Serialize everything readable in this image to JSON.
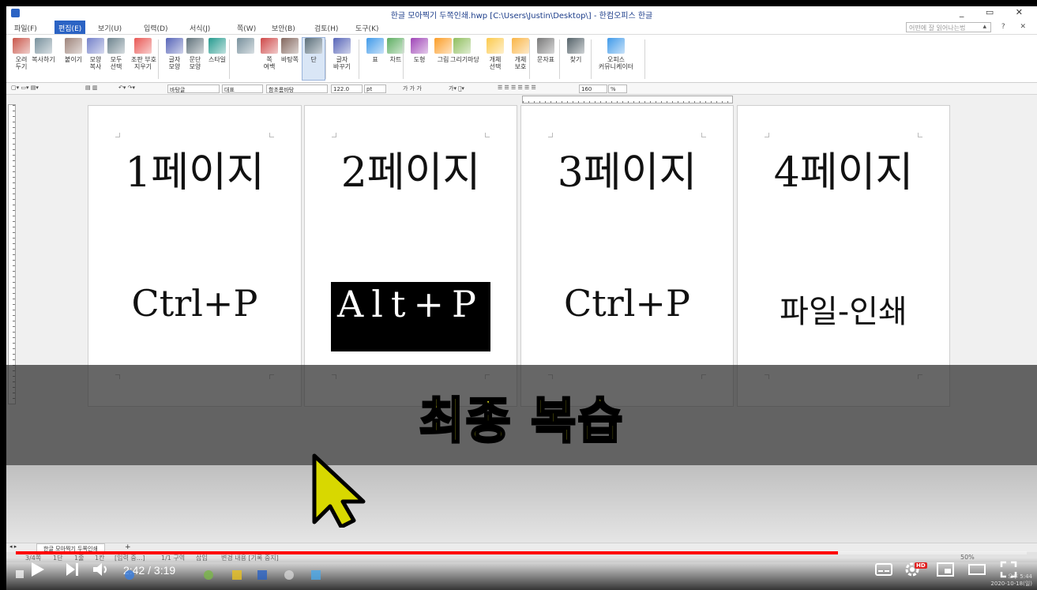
{
  "window": {
    "title": "한글 모아찍기 두쪽인쇄.hwp [C:\\Users\\Justin\\Desktop\\] - 한컴오피스 한글",
    "controls": "_ ▭ ✕"
  },
  "menu": {
    "items": [
      "파일(F)",
      "편집(E)",
      "보기(U)",
      "입력(D)",
      "서식(J)",
      "쪽(W)",
      "보안(B)",
      "검토(H)",
      "도구(K)"
    ],
    "active_index": 1,
    "help_placeholder": "어떤에 잘 읽어나는법",
    "right_controls": "▴ ? ✕"
  },
  "ribbon": {
    "buttons": [
      {
        "label": "오려\n두기",
        "icon": "scissors-icon"
      },
      {
        "label": "복사하기",
        "icon": "copy-icon"
      },
      {
        "label": "붙이기",
        "icon": "paste-icon"
      },
      {
        "label": "모양\n복사",
        "icon": "format-painter-icon"
      },
      {
        "label": "모두\n선택",
        "icon": "select-all-icon"
      },
      {
        "label": "조판 부호\n지우기",
        "icon": "delete-code-icon"
      },
      {
        "label": "글자\n모양",
        "icon": "char-shape-icon"
      },
      {
        "label": "문단\n모양",
        "icon": "para-shape-icon"
      },
      {
        "label": "스타일",
        "icon": "style-icon"
      },
      {
        "label": "",
        "icon": "page-icon"
      },
      {
        "label": "쪽\n여백",
        "icon": "margin-icon"
      },
      {
        "label": "바탕쪽",
        "icon": "master-page-icon"
      },
      {
        "label": "단",
        "icon": "columns-icon"
      },
      {
        "label": "글자\n바꾸기",
        "icon": "replace-char-icon"
      },
      {
        "label": "표",
        "icon": "table-icon"
      },
      {
        "label": "차트",
        "icon": "chart-icon"
      },
      {
        "label": "도형",
        "icon": "shape-icon"
      },
      {
        "label": "그림",
        "icon": "picture-icon"
      },
      {
        "label": "그리기마당",
        "icon": "clipart-icon"
      },
      {
        "label": "개체\n선택",
        "icon": "object-select-icon"
      },
      {
        "label": "개체\n보호",
        "icon": "object-protect-icon"
      },
      {
        "label": "문자표",
        "icon": "symbol-icon"
      },
      {
        "label": "찾기",
        "icon": "binoculars-icon"
      },
      {
        "label": "오피스\n커뮤니케이터",
        "icon": "communicator-icon"
      }
    ]
  },
  "format_toolbar": {
    "style": "바탕글",
    "font_lang": "대표",
    "font": "함초롬바탕",
    "size": "122.0",
    "unit": "pt",
    "bold_italic": "가 가 가",
    "zoom": "160",
    "zoom_unit": "%"
  },
  "pages": [
    {
      "heading": "1페이지",
      "shortcut": "Ctrl+P",
      "highlighted": false
    },
    {
      "heading": "2페이지",
      "shortcut": "Alt+P",
      "highlighted": true
    },
    {
      "heading": "3페이지",
      "shortcut": "Ctrl+P",
      "highlighted": false
    },
    {
      "heading": "4페이지",
      "shortcut": "파일-인쇄",
      "highlighted": false
    }
  ],
  "banner": {
    "text": "최종 복습",
    "color": "#ffff1e"
  },
  "doc_tab": {
    "label": "한글 모아찍기 두쪽인쇄",
    "add": "+"
  },
  "status": {
    "page": "3/4쪽",
    "section": "1단",
    "line": "1줄",
    "col": "1칸",
    "input": "[입력 중...]",
    "section2": "1/1 구역",
    "mode": "삽입",
    "track": "변경 내용 [기록 중지]",
    "zoom": "50%"
  },
  "video": {
    "time": "2:42 / 3:19",
    "progress_fraction": 0.813,
    "quality_badge": "HD",
    "played_color": "#ff0000"
  },
  "clock": {
    "time": "오후 5:44",
    "date": "2020-10-18(일)"
  }
}
